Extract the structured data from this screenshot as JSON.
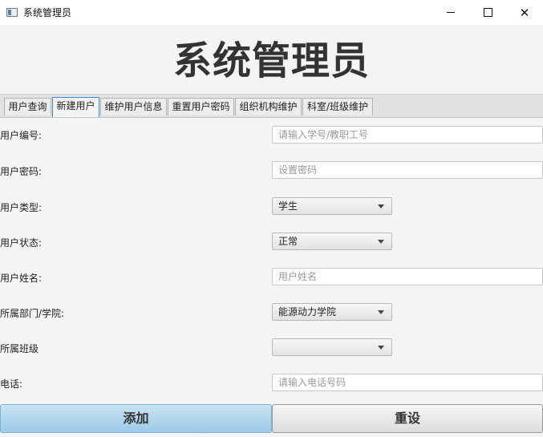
{
  "window": {
    "title": "系统管理员",
    "minimize_glyph": "—",
    "close_glyph": "✕"
  },
  "heading": "系统管理员",
  "tabs": [
    {
      "label": "用户查询",
      "active": false
    },
    {
      "label": "新建用户",
      "active": true
    },
    {
      "label": "维护用户信息",
      "active": false
    },
    {
      "label": "重置用户密码",
      "active": false
    },
    {
      "label": "组织机构维护",
      "active": false
    },
    {
      "label": "科室/班级维护",
      "active": false
    }
  ],
  "form": {
    "user_id": {
      "label": "用户编号:",
      "value": "",
      "placeholder": "请输入学号/教职工号"
    },
    "password": {
      "label": "用户密码:",
      "value": "",
      "placeholder": "设置密码"
    },
    "user_type": {
      "label": "用户类型:",
      "selected": "学生"
    },
    "user_status": {
      "label": "用户状态:",
      "selected": "正常"
    },
    "user_name": {
      "label": "用户姓名:",
      "value": "",
      "placeholder": "用户姓名"
    },
    "department": {
      "label": "所属部门/学院:",
      "selected": "能源动力学院"
    },
    "class": {
      "label": "所属班级",
      "selected": ""
    },
    "phone": {
      "label": "电话:",
      "value": "",
      "placeholder": "请输入电话号码"
    }
  },
  "buttons": {
    "add": "添加",
    "reset": "重设"
  },
  "colors": {
    "active_tab_border": "#3c8ad8",
    "add_button": "#b3d7ee"
  }
}
